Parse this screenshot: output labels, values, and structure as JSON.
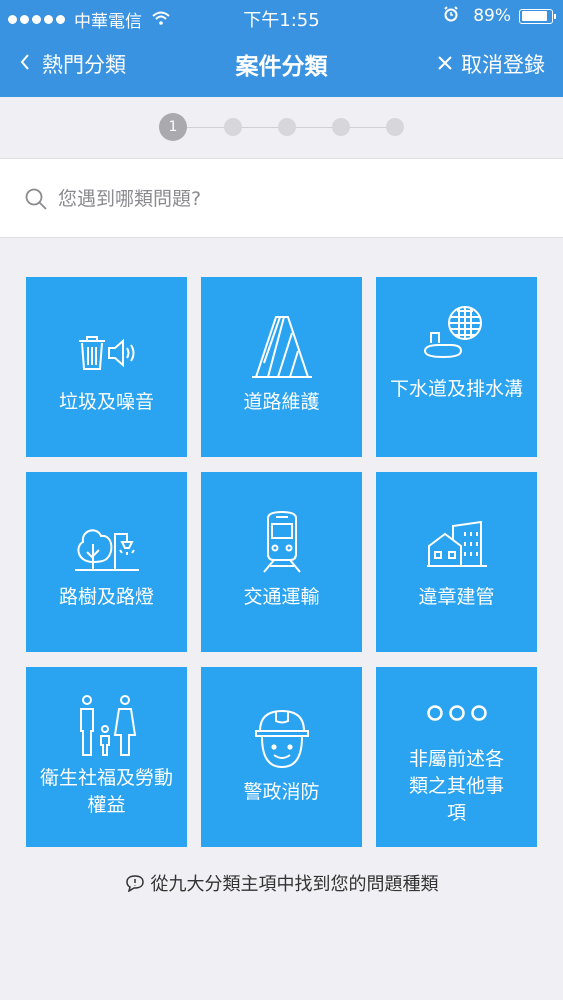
{
  "status_bar": {
    "carrier": "中華電信",
    "time": "下午1:55",
    "battery_percent": "89%",
    "battery_level": 0.89
  },
  "nav": {
    "back_label": "熱門分類",
    "title": "案件分類",
    "cancel_label": "取消登錄"
  },
  "stepper": {
    "current_step_label": "1",
    "total_steps": 5,
    "current_step": 1
  },
  "search": {
    "placeholder": "您遇到哪類問題?"
  },
  "categories": [
    {
      "label": "垃圾及噪音",
      "icon": "trash-speaker-icon"
    },
    {
      "label": "道路維護",
      "icon": "traffic-cone-icon"
    },
    {
      "label": "下水道及排水溝",
      "icon": "manhole-drain-icon"
    },
    {
      "label": "路樹及路燈",
      "icon": "tree-streetlight-icon"
    },
    {
      "label": "交通運輸",
      "icon": "train-icon"
    },
    {
      "label": "違章建管",
      "icon": "buildings-icon"
    },
    {
      "label": "衛生社福及勞動權益",
      "icon": "family-icon"
    },
    {
      "label": "警政消防",
      "icon": "hardhat-worker-icon"
    },
    {
      "label": "非屬前述各類之其他事項",
      "icon": "more-dots-icon"
    }
  ],
  "footer_hint": "從九大分類主項中找到您的問題種類",
  "colors": {
    "nav_bg": "#3a93e0",
    "tile_bg": "#2aa3f0",
    "page_bg": "#efeff4"
  }
}
